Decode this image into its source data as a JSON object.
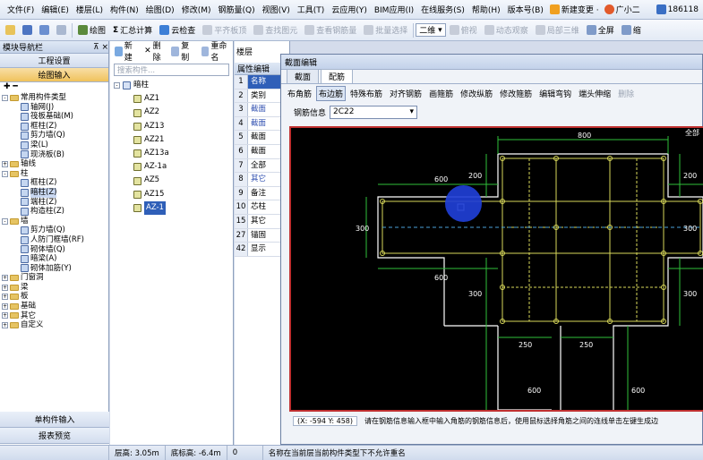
{
  "menu": {
    "items": [
      "文件(F)",
      "编辑(E)",
      "楼层(L)",
      "构件(N)",
      "绘图(D)",
      "修改(M)",
      "钢筋量(Q)",
      "视图(V)",
      "工具(T)",
      "云应用(Y)",
      "BIM应用(I)",
      "在线服务(S)",
      "帮助(H)",
      "版本号(B)"
    ],
    "new_change": "新建变更 ·",
    "user": "广小二",
    "phone": "186118"
  },
  "toolbar": {
    "items": [
      "绘图",
      "汇总计算",
      "云检查",
      "平齐板顶",
      "查找图元",
      "查看钢筋量",
      "批量选择"
    ],
    "view_select": "二维",
    "right_items": [
      "俯视",
      "动态观察",
      "局部三维",
      "全屏",
      "缩"
    ]
  },
  "left_panel": {
    "title": "模块导航栏",
    "sections": [
      "工程设置",
      "绘图输入"
    ],
    "tree": [
      {
        "label": "常用构件类型",
        "level": 0,
        "exp": "-",
        "type": "folder"
      },
      {
        "label": "轴网(J)",
        "level": 1,
        "type": "comp"
      },
      {
        "label": "筏板基础(M)",
        "level": 1,
        "type": "comp"
      },
      {
        "label": "框柱(Z)",
        "level": 1,
        "type": "comp"
      },
      {
        "label": "剪力墙(Q)",
        "level": 1,
        "type": "comp"
      },
      {
        "label": "梁(L)",
        "level": 1,
        "type": "comp"
      },
      {
        "label": "现浇板(B)",
        "level": 1,
        "type": "comp"
      },
      {
        "label": "轴线",
        "level": 0,
        "exp": "+",
        "type": "folder"
      },
      {
        "label": "柱",
        "level": 0,
        "exp": "-",
        "type": "folder"
      },
      {
        "label": "框柱(Z)",
        "level": 1,
        "type": "comp"
      },
      {
        "label": "暗柱(Z)",
        "level": 1,
        "type": "comp"
      },
      {
        "label": "端柱(Z)",
        "level": 1,
        "type": "comp"
      },
      {
        "label": "构造柱(Z)",
        "level": 1,
        "type": "comp"
      },
      {
        "label": "墙",
        "level": 0,
        "exp": "-",
        "type": "folder"
      },
      {
        "label": "剪力墙(Q)",
        "level": 1,
        "type": "comp"
      },
      {
        "label": "人防门框墙(RF)",
        "level": 1,
        "type": "comp"
      },
      {
        "label": "砌体墙(Q)",
        "level": 1,
        "type": "comp"
      },
      {
        "label": "暗梁(A)",
        "level": 1,
        "type": "comp"
      },
      {
        "label": "砌体加筋(Y)",
        "level": 1,
        "type": "comp"
      },
      {
        "label": "门窗洞",
        "level": 0,
        "exp": "+",
        "type": "folder"
      },
      {
        "label": "梁",
        "level": 0,
        "exp": "+",
        "type": "folder"
      },
      {
        "label": "板",
        "level": 0,
        "exp": "+",
        "type": "folder"
      },
      {
        "label": "基础",
        "level": 0,
        "exp": "+",
        "type": "folder"
      },
      {
        "label": "其它",
        "level": 0,
        "exp": "+",
        "type": "folder"
      },
      {
        "label": "自定义",
        "level": 0,
        "exp": "+",
        "type": "folder"
      }
    ],
    "bottom_tabs": [
      "单构件输入",
      "报表预览"
    ]
  },
  "mid_panel": {
    "tools": [
      "新建",
      "删除",
      "复制",
      "重命名",
      "楼层"
    ],
    "search_placeholder": "搜索构件...",
    "root": "暗柱",
    "components": [
      "AZ1",
      "AZ2",
      "AZ13",
      "AZ21",
      "AZ13a",
      "AZ-1a",
      "AZ5",
      "AZ15",
      "AZ-1"
    ]
  },
  "prop_panel": {
    "title": "属性编辑",
    "rows": [
      [
        "1",
        "名称"
      ],
      [
        "2",
        "类别"
      ],
      [
        "3",
        "截面"
      ],
      [
        "4",
        "截面"
      ],
      [
        "5",
        "截面"
      ],
      [
        "6",
        "截面"
      ],
      [
        "7",
        "全部"
      ],
      [
        "8",
        "其它"
      ],
      [
        "9",
        "备注"
      ],
      [
        "10",
        "芯柱"
      ],
      [
        "15",
        "其它"
      ],
      [
        "27",
        "锚固"
      ],
      [
        "42",
        "显示"
      ]
    ]
  },
  "dialog": {
    "title": "截面编辑",
    "tabs": [
      "截面",
      "配筋"
    ],
    "buttons": [
      "布角筋",
      "布边筋",
      "特殊布筋",
      "对齐钢筋",
      "画箍筋",
      "修改纵筋",
      "修改箍筋",
      "编辑弯钩",
      "端头伸缩",
      "删除"
    ],
    "rebar_label": "钢筋信息",
    "rebar_value": "2C22",
    "dims": {
      "top": "800",
      "d200a": "200",
      "d200b": "200",
      "d600l": "600",
      "d600r": "600",
      "d300l": "300",
      "d300r": "300",
      "d600bl": "600",
      "d600br": "600",
      "d300bl": "300",
      "d300br": "300",
      "d250l": "250",
      "d250r": "250",
      "d600vl": "600",
      "d600vr": "600",
      "note": "全部"
    },
    "coords": "(X: -594 Y: 458)",
    "hint": "请在钢筋信息输入框中输入角筋的钢筋信息后，使用鼠标选择角筋之间的连线单击左键生成边"
  },
  "status": {
    "floor_height": "层高: 3.05m",
    "bottom_height": "底标高: -6.4m",
    "zero": "0",
    "message": "名称在当前层当前构件类型下不允许重名"
  },
  "colors": {
    "accent": "#2f5fb8",
    "canvas_bg": "#000000",
    "outline": "#ffffff",
    "rebar": "#d8d85a",
    "dim": "#2fbf3a"
  }
}
